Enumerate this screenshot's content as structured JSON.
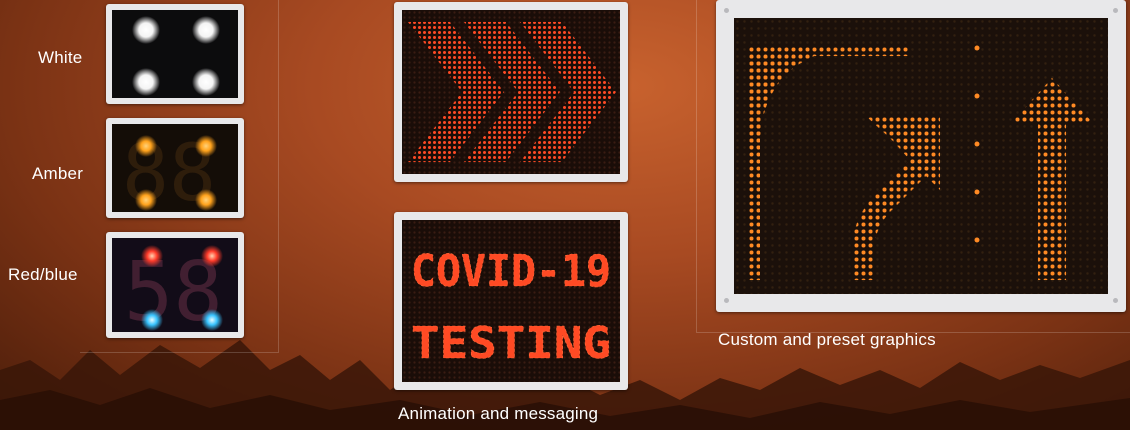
{
  "color_options": [
    {
      "label": "White"
    },
    {
      "label": "Amber"
    },
    {
      "label": "Red/blue"
    }
  ],
  "speed_digits": "58",
  "message_lines": [
    "COVID-19",
    "TESTING"
  ],
  "captions": {
    "animation": "Animation and messaging",
    "graphics": "Custom and preset graphics"
  },
  "colors": {
    "white_led": "#ffffff",
    "amber_led": "#ffa21c",
    "red_led": "#ff3b2a",
    "blue_led": "#39c4ff",
    "orange_led": "#ff7a1e"
  }
}
